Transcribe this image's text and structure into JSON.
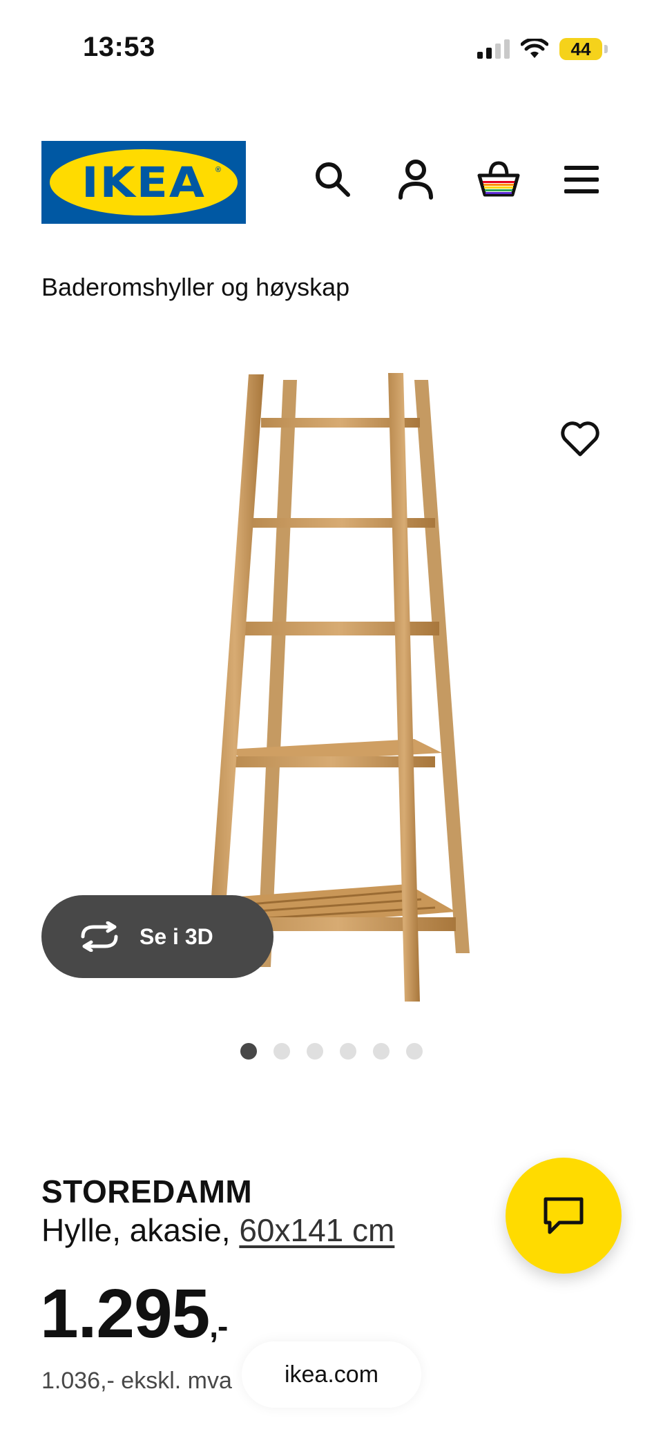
{
  "status_bar": {
    "time": "13:53",
    "battery": "44"
  },
  "header": {
    "logo_text": "IKEA",
    "logo_mark": "®",
    "icons": [
      "search-icon",
      "account-icon",
      "cart-icon",
      "menu-icon"
    ]
  },
  "breadcrumb": "Baderomshyller og høyskap",
  "gallery": {
    "view_3d_label": "Se i 3D",
    "image_count": 6,
    "active_index": 0
  },
  "product": {
    "name": "STOREDAMM",
    "description": "Hylle, akasie, ",
    "size": "60x141 cm",
    "price": "1.295",
    "price_suffix": ",-",
    "price_ex_vat": "1.036,- ekskl. mva"
  },
  "browser": {
    "url": "ikea.com"
  },
  "colors": {
    "brand_blue": "#0058a3",
    "brand_yellow": "#ffdb00",
    "dark_gray": "#484848"
  }
}
